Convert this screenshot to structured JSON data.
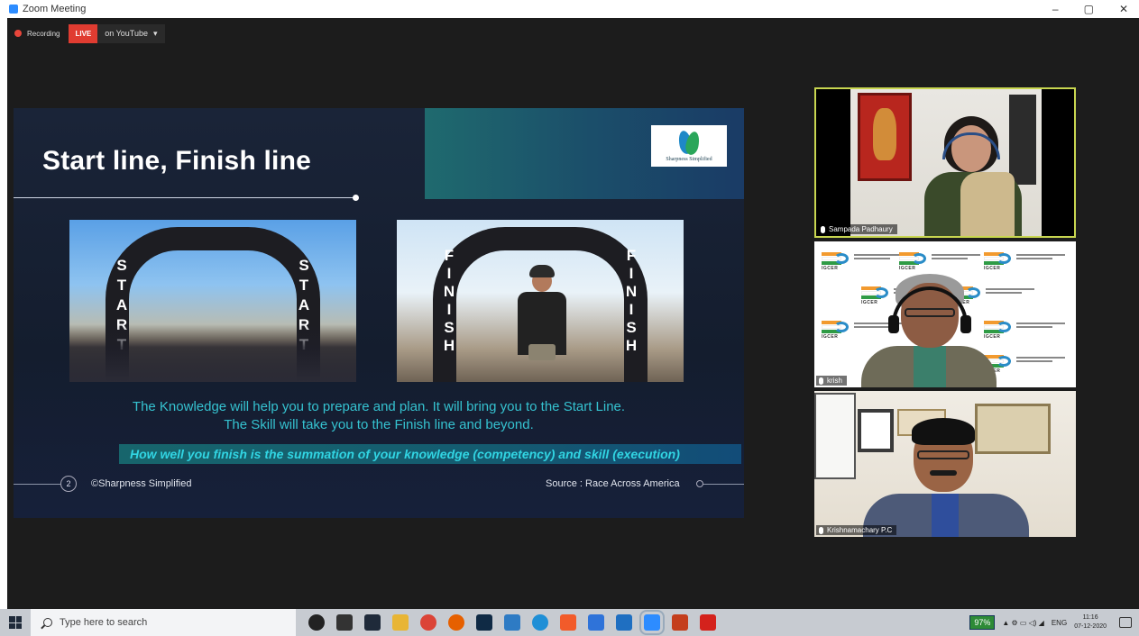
{
  "window": {
    "title": "Zoom Meeting",
    "minimize": "–",
    "maximize": "▢",
    "close": "✕"
  },
  "recording": {
    "label": "Recording",
    "live": "LIVE",
    "platform": "on YouTube",
    "caret": "▾"
  },
  "slide": {
    "title": "Start line, Finish line",
    "logo_text": "Sharpness Simplified",
    "start_letters": [
      "S",
      "T",
      "A",
      "R",
      "T"
    ],
    "finish_letters": [
      "F",
      "I",
      "N",
      "I",
      "S",
      "H"
    ],
    "caption_line1": "The Knowledge will help you to prepare and plan. It will bring you to the Start Line.",
    "caption_line2": "The Skill will take you to the Finish line and beyond.",
    "highlight": "How well you finish is the summation of your knowledge (competency) and skill (execution)",
    "page_number": "2",
    "copyright": "©Sharpness Simplified",
    "source": "Source : Race Across America"
  },
  "participants": [
    {
      "name": "Sampada Padhaury",
      "active_speaker": true
    },
    {
      "name": "krish",
      "active_speaker": false
    },
    {
      "name": "Krishnamachary P.C",
      "active_speaker": false
    }
  ],
  "tile2_logo_text": "IGCER",
  "taskbar": {
    "search_placeholder": "Type here to search",
    "apps": [
      {
        "name": "cortana-icon",
        "color": "#222222",
        "circle": true
      },
      {
        "name": "task-view-icon",
        "color": "#333333"
      },
      {
        "name": "store-icon",
        "color": "#1f2a3a"
      },
      {
        "name": "file-explorer-icon",
        "color": "#e8b535"
      },
      {
        "name": "chrome-icon",
        "color": "#db4437",
        "circle": true
      },
      {
        "name": "firefox-icon",
        "color": "#e66000",
        "circle": true
      },
      {
        "name": "photoshop-icon",
        "color": "#0f2a45"
      },
      {
        "name": "lync-icon",
        "color": "#2e7bc4"
      },
      {
        "name": "edge-icon",
        "color": "#1f8fd6",
        "circle": true
      },
      {
        "name": "brave-icon",
        "color": "#f25b2a"
      },
      {
        "name": "phone-icon",
        "color": "#2f73d9"
      },
      {
        "name": "mail-icon",
        "color": "#1f6fc1"
      },
      {
        "name": "zoom-icon",
        "color": "#2d8cff",
        "active": true
      },
      {
        "name": "powerpoint-icon",
        "color": "#c43e1c"
      },
      {
        "name": "acrobat-icon",
        "color": "#d4221c"
      }
    ],
    "battery": "97%",
    "language": "ENG",
    "time": "11:16",
    "date": "07-12-2020"
  }
}
